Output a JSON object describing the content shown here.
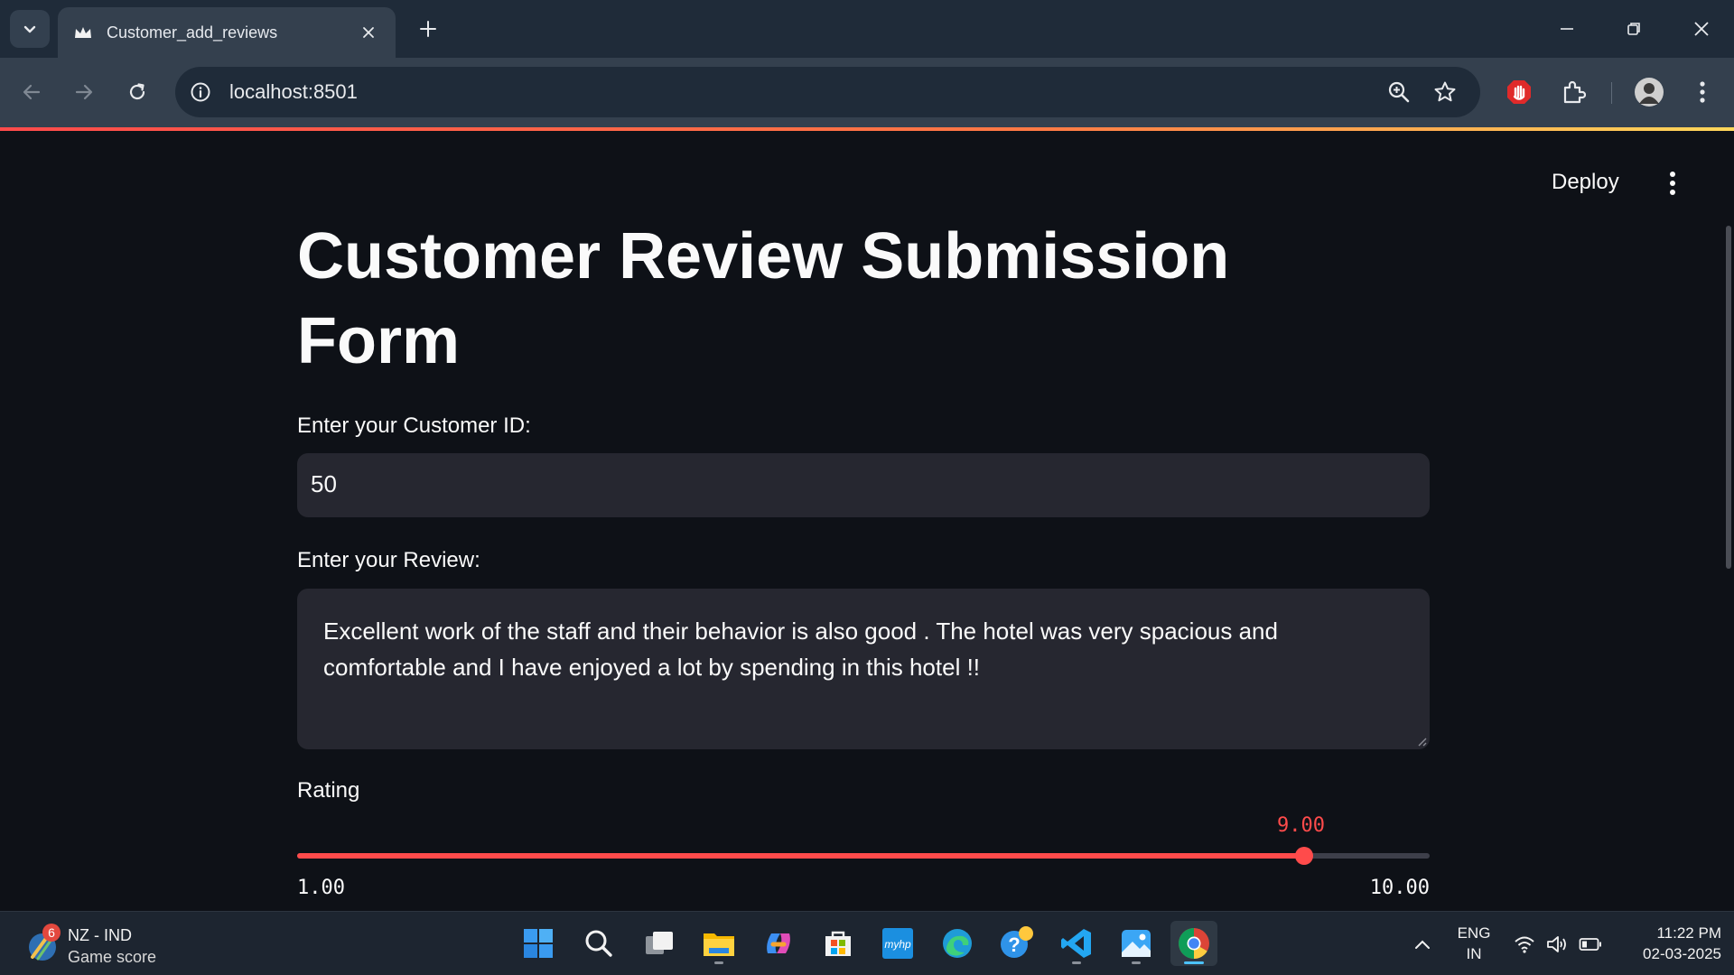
{
  "browser": {
    "tab_title": "Customer_add_reviews",
    "url": "localhost:8501"
  },
  "app": {
    "deploy_label": "Deploy",
    "title": "Customer Review Submission Form",
    "customer_id_label": "Enter your Customer ID:",
    "customer_id_value": "50",
    "review_label": "Enter your Review:",
    "review_value": "Excellent work of the staff and their behavior is also good . The hotel was very spacious and comfortable and I have enjoyed a lot by spending in this hotel !!",
    "rating_label": "Rating",
    "rating": {
      "value": 9.0,
      "value_text": "9.00",
      "min": 1.0,
      "min_text": "1.00",
      "max": 10.0,
      "max_text": "10.00"
    }
  },
  "taskbar": {
    "widget_badge": "6",
    "widget_title": "NZ - IND",
    "widget_subtitle": "Game score",
    "apps": [
      "start-icon",
      "search-icon",
      "task-view-icon",
      "file-explorer-icon",
      "copilot-icon",
      "microsoft-store-icon",
      "myhp-icon",
      "edge-icon",
      "get-help-icon",
      "vscode-icon",
      "photos-icon",
      "chrome-icon"
    ],
    "myhp_text": "myhp",
    "lang_line1": "ENG",
    "lang_line2": "IN",
    "time": "11:22 PM",
    "date": "02-03-2025"
  },
  "colors": {
    "accent": "#ff4b4b",
    "background": "#0e1117",
    "input_bg": "#262730",
    "chrome_frame": "#1f2b39"
  }
}
